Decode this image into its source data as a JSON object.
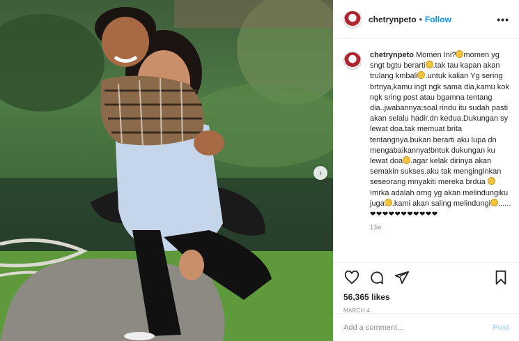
{
  "post": {
    "username": "chetrynpeto",
    "follow_label": "Follow",
    "separator": "•",
    "more_label": "•••",
    "carousel_next_label": "›"
  },
  "caption": {
    "username": "chetrynpeto",
    "segments": [
      "Momen Ini?",
      "momen yg sngt bgtu berarti",
      ".tak tau kapan akan trulang kmbali",
      ".untuk kalian Yg sering brtnya,kamu ingt ngk sama dia,kamu kok ngk sring post atau bgamna tentang dia..jwabannya:soal rindu itu sudah pasti akan selalu hadir.dn kedua.Dukungan sy lewat doa.tak memuat brita tentangnya.bukan berarti aku lupa dn mengabaikannya!bntuk dukungan ku lewat doa",
      ".agar kelak dirinya akan semakin sukses.aku tak menginginkan seseorang mnyakiti mereka brdua ",
      "!mrka adalah orng yg akan melindungiku juga",
      ".kami akan saling melindungi",
      "......"
    ],
    "hearts": "❤❤❤❤❤❤❤❤❤❤❤"
  },
  "meta": {
    "time_ago": "13w",
    "likes": "56,365 likes",
    "date": "March 4"
  },
  "comment_box": {
    "placeholder": "Add a comment...",
    "post_label": "Post"
  },
  "icons": {
    "like": "heart-icon",
    "comment": "comment-icon",
    "share": "share-icon",
    "save": "bookmark-icon",
    "carousel": "chevron-right-icon"
  },
  "colors": {
    "accent": "#0095f6",
    "post_disabled": "#b3dbff",
    "muted": "#8e8e8e",
    "text": "#262626",
    "divider": "#efefef"
  }
}
